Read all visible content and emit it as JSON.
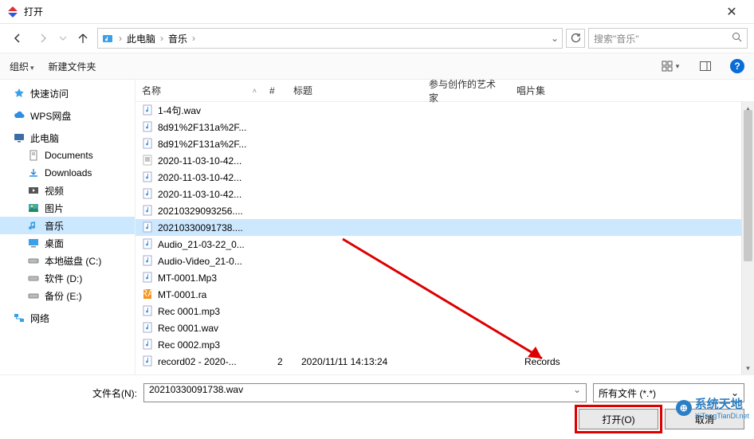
{
  "window": {
    "title": "打开"
  },
  "nav": {
    "crumbs": [
      "此电脑",
      "音乐"
    ],
    "search_placeholder": "搜索\"音乐\""
  },
  "toolbar": {
    "organize": "组织",
    "new_folder": "新建文件夹"
  },
  "sidebar": {
    "quick": "快速访问",
    "wps": "WPS网盘",
    "this_pc": "此电脑",
    "documents": "Documents",
    "downloads": "Downloads",
    "videos": "视频",
    "pictures": "图片",
    "music": "音乐",
    "desktop": "桌面",
    "local_c": "本地磁盘 (C:)",
    "soft_d": "软件 (D:)",
    "backup_e": "备份 (E:)",
    "network": "网络"
  },
  "columns": {
    "name": "名称",
    "num": "#",
    "title": "标题",
    "artist": "参与创作的艺术家",
    "album": "唱片集"
  },
  "files": [
    {
      "name": "1-4句.wav",
      "type": "audio"
    },
    {
      "name": "8d91%2F131a%2F...",
      "type": "audio"
    },
    {
      "name": "8d91%2F131a%2F...",
      "type": "audio"
    },
    {
      "name": "2020-11-03-10-42...",
      "type": "text"
    },
    {
      "name": "2020-11-03-10-42...",
      "type": "audio"
    },
    {
      "name": "2020-11-03-10-42...",
      "type": "audio"
    },
    {
      "name": "20210329093256....",
      "type": "audio"
    },
    {
      "name": "20210330091738....",
      "type": "audio",
      "selected": true
    },
    {
      "name": "Audio_21-03-22_0...",
      "type": "audio"
    },
    {
      "name": "Audio-Video_21-0...",
      "type": "audio"
    },
    {
      "name": "MT-0001.Mp3",
      "type": "audio"
    },
    {
      "name": "MT-0001.ra",
      "type": "ra"
    },
    {
      "name": "Rec 0001.mp3",
      "type": "audio"
    },
    {
      "name": "Rec 0001.wav",
      "type": "audio"
    },
    {
      "name": "Rec 0002.mp3",
      "type": "audio"
    },
    {
      "name": "record02 - 2020-...",
      "type": "audio",
      "num": "2",
      "title": "2020/11/11 14:13:24",
      "album": "Records"
    }
  ],
  "bottom": {
    "filename_label": "文件名(N):",
    "filename_value": "20210330091738.wav",
    "filter": "所有文件 (*.*)",
    "open": "打开(O)",
    "cancel": "取消"
  },
  "watermark": {
    "cn": "系统天地",
    "url": "XiTongTianDi.net"
  }
}
